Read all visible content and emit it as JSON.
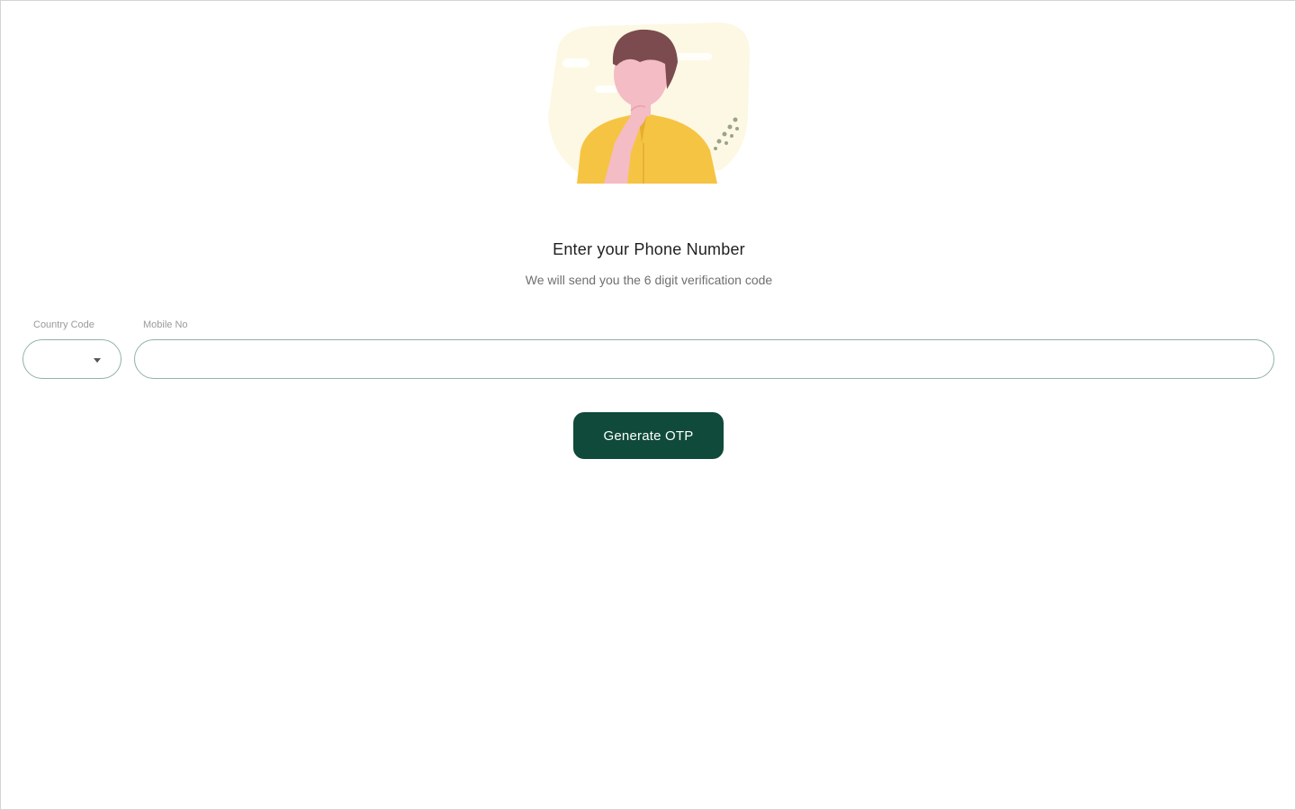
{
  "header": {
    "title": "Enter your Phone Number",
    "subtitle": "We will send you the 6 digit verification code"
  },
  "form": {
    "country_code": {
      "label": "Country Code",
      "value": ""
    },
    "mobile": {
      "label": "Mobile No",
      "value": "",
      "placeholder": ""
    },
    "submit_label": "Generate OTP"
  },
  "colors": {
    "primary_button": "#0f4a3a",
    "input_border": "#8fb3a6",
    "shirt": "#f6c443",
    "hair": "#7b4b4f",
    "skin": "#f4bcc4",
    "background_blob": "#fdf8e4"
  },
  "icons": {
    "illustration": "thinking-person-illustration",
    "dropdown": "caret-down-icon"
  }
}
